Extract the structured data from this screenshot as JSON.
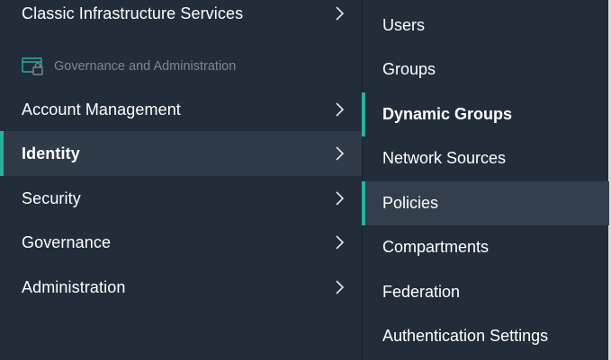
{
  "left_menu": {
    "top_item": {
      "label": "Classic Infrastructure Services"
    },
    "section_header": {
      "label": "Governance and Administration",
      "icon": "governance-icon"
    },
    "items": [
      {
        "label": "Account Management",
        "active": false
      },
      {
        "label": "Identity",
        "active": true
      },
      {
        "label": "Security",
        "active": false
      },
      {
        "label": "Governance",
        "active": false
      },
      {
        "label": "Administration",
        "active": false
      }
    ],
    "chevron_icon": "chevron-right-icon"
  },
  "submenu": {
    "items": [
      {
        "label": "Users"
      },
      {
        "label": "Groups"
      },
      {
        "label": "Dynamic Groups",
        "selected": true
      },
      {
        "label": "Network Sources"
      },
      {
        "label": "Policies",
        "hovered": true
      },
      {
        "label": "Compartments"
      },
      {
        "label": "Federation"
      },
      {
        "label": "Authentication Settings"
      }
    ]
  },
  "colors": {
    "panel_bg": "#232d3a",
    "active_bg": "#303b49",
    "hover_bg": "#343f4d",
    "accent": "#2bb0a0",
    "text": "#ffffff",
    "muted_text": "#7d8793"
  }
}
